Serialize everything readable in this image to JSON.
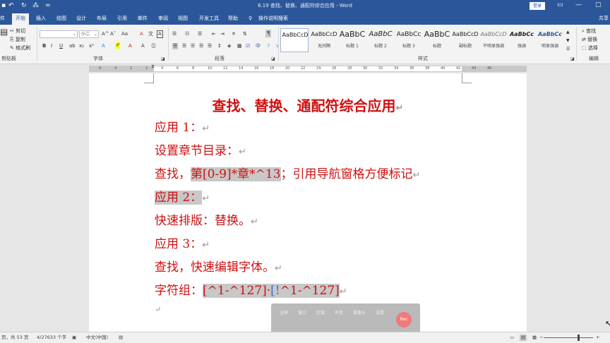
{
  "window": {
    "title": "6.19 查找、替换、通配符综合应用 - Word",
    "login": "登录",
    "minimize": "▭",
    "maximize": "—",
    "restore": "▢"
  },
  "quick_access": {
    "save": "▪",
    "undo": "↶",
    "redo": "↻",
    "share": "⁂",
    "more": "="
  },
  "tabs": [
    "件",
    "开始",
    "插入",
    "绘图",
    "设计",
    "布局",
    "引用",
    "邮件",
    "审阅",
    "视图",
    "开发工具",
    "帮助"
  ],
  "tell_me": "操作说明搜索",
  "share": "共享",
  "ribbon": {
    "clipboard": {
      "cut": "剪切",
      "copy": "复制",
      "painter": "格式刷",
      "group": "剪贴板"
    },
    "font": {
      "name": "",
      "size": "小二",
      "bold": "B",
      "italic": "I",
      "underline": "U",
      "group": "字体",
      "grow": "A^",
      "shrink": "A˅",
      "case": "Aa",
      "clear": "A",
      "wen": "文",
      "pinyin": "A"
    },
    "paragraph": {
      "group": "段落",
      "zh": "中"
    },
    "styles": {
      "group": "样式",
      "items": [
        {
          "preview": "AaBbCcD",
          "name": ""
        },
        {
          "preview": "AaBbCcD",
          "name": "无间隔"
        },
        {
          "preview": "AaBbC",
          "name": "标题 1"
        },
        {
          "preview": "AaBbC",
          "name": "标题 2"
        },
        {
          "preview": "AaBbCc",
          "name": "标题 3"
        },
        {
          "preview": "AaBbC",
          "name": "标题"
        },
        {
          "preview": "AaBbCcD",
          "name": "副标题"
        },
        {
          "preview": "AaBbCcD",
          "name": "不明显强调"
        },
        {
          "preview": "AaBbCc",
          "name": "强调"
        },
        {
          "preview": "AaBbCc",
          "name": "明显强调"
        }
      ]
    },
    "editing": {
      "find": "查找",
      "replace": "替换",
      "select": "选择",
      "group": "编辑"
    }
  },
  "ruler": {
    "ticks": [
      "6",
      "4",
      "2",
      "2",
      "4",
      "6",
      "8",
      "10",
      "12",
      "14",
      "16",
      "18",
      "20",
      "22",
      "24",
      "26",
      "28",
      "30",
      "32",
      "34",
      "36",
      "38",
      "40",
      "42",
      "44",
      "46"
    ]
  },
  "document": {
    "title": "查找、替换、通配符综合应用",
    "lines": [
      {
        "parts": [
          {
            "text": "应用 1："
          }
        ]
      },
      {
        "parts": [
          {
            "text": "设置章节目录："
          }
        ]
      },
      {
        "parts": [
          {
            "text": "查找，"
          },
          {
            "text": "第[0-9]*章*^13",
            "style": "hl"
          },
          {
            "text": "；引用导航窗格方便标记"
          }
        ]
      },
      {
        "parts": [
          {
            "text": "应用 2：",
            "style": "hl"
          }
        ]
      },
      {
        "parts": [
          {
            "text": "快速排版：替换。"
          }
        ]
      },
      {
        "parts": [
          {
            "text": "应用 3："
          }
        ]
      },
      {
        "parts": [
          {
            "text": "查找，快速编辑字体。"
          }
        ]
      },
      {
        "parts": [
          {
            "text": "字符组："
          },
          {
            "text": "[^1-^127]·",
            "style": "hl"
          },
          {
            "text": "[!",
            "style": "hl blue"
          },
          {
            "text": "^1-^127]",
            "style": "hl"
          }
        ]
      }
    ],
    "para_mark": "↵"
  },
  "float_toolbar": {
    "items": [
      "全屏",
      "窗口",
      "区域",
      "声音",
      "摄像头",
      "设置"
    ],
    "record": "Rec"
  },
  "status": {
    "page": "页，共 53 页",
    "words": "4/27633 个字",
    "lang": "中文(中国)"
  }
}
